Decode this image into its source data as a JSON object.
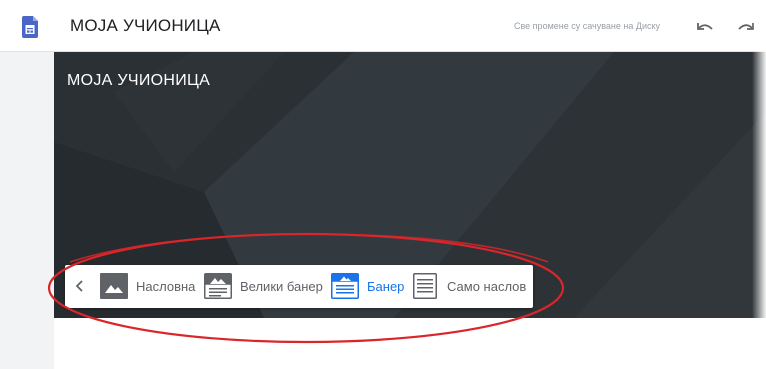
{
  "app": {
    "title": "МОЈА УЧИОНИЦА",
    "save_status": "Све промене су сачуване на Диску",
    "icons": {
      "logo": "google-sites-icon",
      "undo": "undo-icon",
      "redo": "redo-icon"
    }
  },
  "header": {
    "site_title": "МОЈА УЧИОНИЦА"
  },
  "header_types": {
    "previous_icon": "chevron-left-icon",
    "options": [
      {
        "label": "Насловна",
        "icon": "cover-image-icon",
        "selected": false
      },
      {
        "label": "Велики банер",
        "icon": "large-banner-icon",
        "selected": false
      },
      {
        "label": "Банер",
        "icon": "banner-icon",
        "selected": true
      },
      {
        "label": "Само наслов",
        "icon": "title-only-icon",
        "selected": false
      }
    ]
  },
  "colors": {
    "accent": "#1a73e8",
    "banner_dark": "#2e3438",
    "highlight_oval": "#d9262a",
    "app_icon": "#4a66c6"
  }
}
